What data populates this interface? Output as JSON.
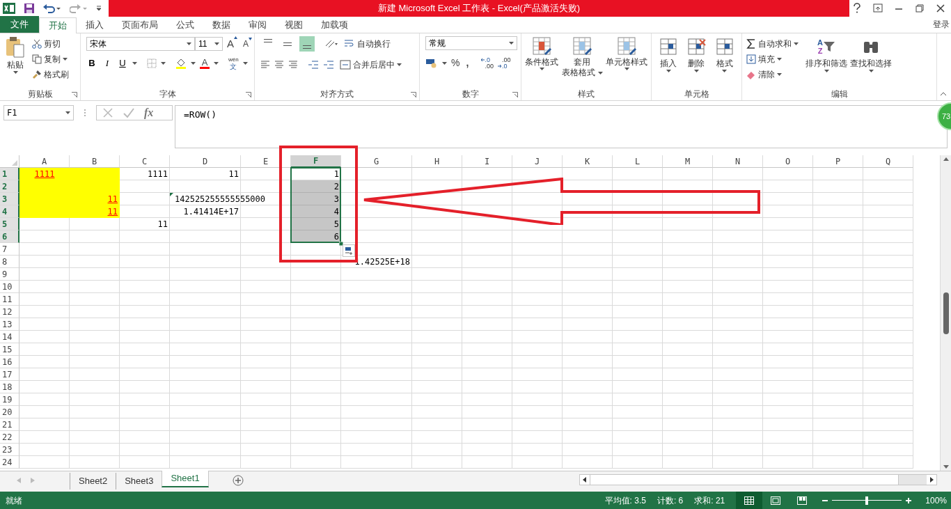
{
  "title_bar": {
    "title": "新建 Microsoft Excel 工作表 -  Excel(产品激活失败)",
    "sign_in": "登录"
  },
  "tabs": [
    {
      "label": "文件",
      "kind": "file",
      "selected": false
    },
    {
      "label": "开始",
      "kind": "tab",
      "selected": true
    },
    {
      "label": "插入",
      "kind": "tab",
      "selected": false
    },
    {
      "label": "页面布局",
      "kind": "tab",
      "selected": false
    },
    {
      "label": "公式",
      "kind": "tab",
      "selected": false
    },
    {
      "label": "数据",
      "kind": "tab",
      "selected": false
    },
    {
      "label": "审阅",
      "kind": "tab",
      "selected": false
    },
    {
      "label": "视图",
      "kind": "tab",
      "selected": false
    },
    {
      "label": "加载项",
      "kind": "tab",
      "selected": false
    }
  ],
  "ribbon": {
    "clipboard": {
      "title": "剪贴板",
      "paste": "粘贴",
      "cut": "剪切",
      "copy": "复制",
      "format_painter": "格式刷"
    },
    "font": {
      "title": "字体",
      "font_name": "宋体",
      "font_size": "11",
      "grow": "A",
      "shrink": "A",
      "bold": "B",
      "italic": "I",
      "underline": "U",
      "font_color": "A",
      "phonetic_top": "wén",
      "phonetic_bottom": "文"
    },
    "alignment": {
      "title": "对齐方式",
      "vertical": [
        {
          "selected": false
        },
        {
          "selected": false
        },
        {
          "selected": true
        }
      ],
      "wrap": "自动换行",
      "merge": "合并后居中"
    },
    "number": {
      "title": "数字",
      "format": "常规",
      "percent": "%",
      "comma": ",",
      "increase_decimal": [
        ".0",
        ".00"
      ],
      "decrease_decimal": [
        ".00",
        ".0"
      ]
    },
    "styles": {
      "title": "样式",
      "items": [
        {
          "label": "条件格式"
        },
        {
          "label": "套用",
          "label_2": "表格格式"
        },
        {
          "label": "单元格样式"
        }
      ]
    },
    "cells": {
      "title": "单元格",
      "items": [
        "插入",
        "删除",
        "格式"
      ]
    },
    "editing": {
      "title": "编辑",
      "sort_icon": [
        "A",
        "Z"
      ],
      "autosum": "自动求和",
      "fill": "填充",
      "clear": "清除",
      "sort": "排序和筛选",
      "find": "查找和选择"
    }
  },
  "formula_bar": {
    "name_box": "F1",
    "fx": "fx",
    "formula": "=ROW()",
    "badge": "73"
  },
  "columns": [
    {
      "label": "A",
      "selected": false
    },
    {
      "label": "B",
      "selected": false
    },
    {
      "label": "C",
      "selected": false
    },
    {
      "label": "D",
      "selected": false
    },
    {
      "label": "E",
      "selected": false
    },
    {
      "label": "F",
      "selected": true
    },
    {
      "label": "G",
      "selected": false
    },
    {
      "label": "H",
      "selected": false
    },
    {
      "label": "I",
      "selected": false
    },
    {
      "label": "J",
      "selected": false
    },
    {
      "label": "K",
      "selected": false
    },
    {
      "label": "L",
      "selected": false
    },
    {
      "label": "M",
      "selected": false
    },
    {
      "label": "N",
      "selected": false
    },
    {
      "label": "O",
      "selected": false
    },
    {
      "label": "P",
      "selected": false
    },
    {
      "label": "Q",
      "selected": false
    }
  ],
  "rows": [
    {
      "header": "1",
      "selected": true,
      "cells": [
        {
          "kind": "centered_link",
          "text": "1111",
          "color": "#ffff00"
        },
        {
          "kind": "empty",
          "color": "#ffff00"
        },
        {
          "kind": "number",
          "text": "1111"
        },
        {
          "kind": "number",
          "text": "11"
        },
        {
          "kind": "empty"
        },
        {
          "kind": "number",
          "text": "1"
        }
      ]
    },
    {
      "header": "2",
      "selected": true,
      "cells": [
        {
          "kind": "empty",
          "color": "#ffff00"
        },
        {
          "kind": "empty",
          "color": "#ffff00"
        },
        {
          "kind": "empty"
        },
        {
          "kind": "empty"
        },
        {
          "kind": "empty"
        },
        {
          "kind": "number",
          "text": "2"
        }
      ]
    },
    {
      "header": "3",
      "selected": true,
      "cells": [
        {
          "kind": "empty",
          "color": "#ffff00"
        },
        {
          "kind": "link",
          "text": "11",
          "color": "#ffff00"
        },
        {
          "kind": "empty"
        },
        {
          "kind": "flagged",
          "text": "142525255555555000"
        },
        {
          "kind": "empty"
        },
        {
          "kind": "number",
          "text": "3"
        }
      ]
    },
    {
      "header": "4",
      "selected": true,
      "cells": [
        {
          "kind": "empty",
          "color": "#ffff00"
        },
        {
          "kind": "link",
          "text": "11",
          "color": "#ffff00"
        },
        {
          "kind": "empty"
        },
        {
          "kind": "number",
          "text": "1.41414E+17"
        },
        {
          "kind": "empty"
        },
        {
          "kind": "number",
          "text": "4"
        }
      ]
    },
    {
      "header": "5",
      "selected": true,
      "cells": [
        {
          "kind": "empty"
        },
        {
          "kind": "empty"
        },
        {
          "kind": "number",
          "text": "11"
        },
        {
          "kind": "empty"
        },
        {
          "kind": "empty"
        },
        {
          "kind": "number",
          "text": "5"
        }
      ]
    },
    {
      "header": "6",
      "selected": true,
      "cells": [
        {
          "kind": "empty"
        },
        {
          "kind": "empty"
        },
        {
          "kind": "empty"
        },
        {
          "kind": "empty"
        },
        {
          "kind": "empty"
        },
        {
          "kind": "number",
          "text": "6"
        }
      ]
    },
    {
      "header": "7",
      "selected": false
    },
    {
      "header": "8",
      "selected": false,
      "cells": [
        {
          "kind": "empty"
        },
        {
          "kind": "empty"
        },
        {
          "kind": "empty"
        },
        {
          "kind": "empty"
        },
        {
          "kind": "empty"
        },
        {
          "kind": "empty"
        },
        {
          "kind": "number",
          "text": "1.42525E+18"
        }
      ]
    },
    {
      "header": "9",
      "selected": false
    },
    {
      "header": "10",
      "selected": false
    },
    {
      "header": "11",
      "selected": false
    },
    {
      "header": "12",
      "selected": false
    },
    {
      "header": "13",
      "selected": false
    },
    {
      "header": "14",
      "selected": false
    },
    {
      "header": "15",
      "selected": false
    },
    {
      "header": "16",
      "selected": false
    },
    {
      "header": "17",
      "selected": false
    },
    {
      "header": "18",
      "selected": false
    },
    {
      "header": "19",
      "selected": false
    },
    {
      "header": "20",
      "selected": false
    },
    {
      "header": "21",
      "selected": false
    },
    {
      "header": "22",
      "selected": false
    },
    {
      "header": "23",
      "selected": false
    },
    {
      "header": "24",
      "selected": false
    }
  ],
  "sheets": [
    {
      "label": "Sheet2",
      "selected": false
    },
    {
      "label": "Sheet3",
      "selected": false
    },
    {
      "label": "Sheet1",
      "selected": true
    }
  ],
  "status_bar": {
    "status": "就绪",
    "stats": [
      "平均值: 3.5",
      "计数: 6",
      "求和: 21"
    ],
    "views": [
      {
        "kind": "normal",
        "selected": true
      },
      {
        "kind": "page_layout",
        "selected": false
      },
      {
        "kind": "page_break",
        "selected": false
      }
    ],
    "zoom": {
      "level": 0.5,
      "label": "100%"
    }
  }
}
